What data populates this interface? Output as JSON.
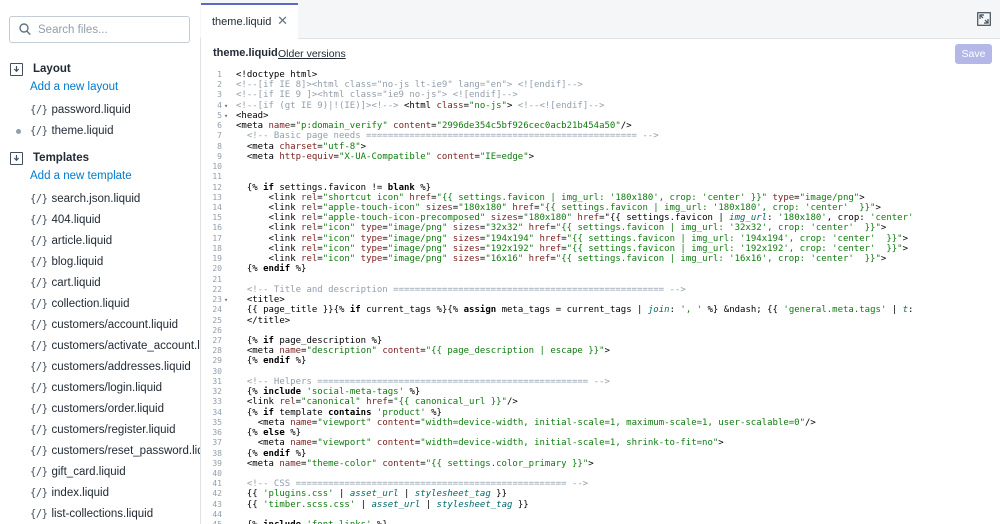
{
  "sidebar": {
    "search_placeholder": "Search files...",
    "sections": [
      {
        "title": "Layout",
        "add_label": "Add a new layout",
        "files": [
          "password.liquid",
          "theme.liquid"
        ]
      },
      {
        "title": "Templates",
        "add_label": "Add a new template",
        "files": [
          "search.json.liquid",
          "404.liquid",
          "article.liquid",
          "blog.liquid",
          "cart.liquid",
          "collection.liquid",
          "customers/account.liquid",
          "customers/activate_account.liquid",
          "customers/addresses.liquid",
          "customers/login.liquid",
          "customers/order.liquid",
          "customers/register.liquid",
          "customers/reset_password.liquid",
          "gift_card.liquid",
          "index.liquid",
          "list-collections.liquid"
        ]
      }
    ],
    "active_file": "theme.liquid"
  },
  "editor": {
    "tab_label": "theme.liquid",
    "file_title": "theme.liquid",
    "older_versions_label": "Older versions",
    "save_label": "Save"
  },
  "code": [
    {
      "n": "1",
      "f": "",
      "t": "<!doctype html>"
    },
    {
      "n": "2",
      "f": "",
      "t": "<!--[if IE 8]><html class=\"no-js lt-ie9\" lang=\"en\"> <![endif]-->"
    },
    {
      "n": "3",
      "f": "",
      "t": "<!--[if IE 9 ]><html class=\"ie9 no-js\"> <![endif]-->"
    },
    {
      "n": "4",
      "f": "▾",
      "t": "<!--[if (gt IE 9)|!(IE)]><!--> <html class=\"no-js\"> <!--<![endif]-->"
    },
    {
      "n": "5",
      "f": "▾",
      "t": "<head>"
    },
    {
      "n": "6",
      "f": "",
      "t": "<meta name=\"p:domain_verify\" content=\"2996de354c5bf926cec0acb21b454a50\"/>"
    },
    {
      "n": "7",
      "f": "",
      "t": "  <!-- Basic page needs ================================================== -->"
    },
    {
      "n": "8",
      "f": "",
      "t": "  <meta charset=\"utf-8\">"
    },
    {
      "n": "9",
      "f": "",
      "t": "  <meta http-equiv=\"X-UA-Compatible\" content=\"IE=edge\">"
    },
    {
      "n": "10",
      "f": "",
      "t": ""
    },
    {
      "n": "11",
      "f": "",
      "t": ""
    },
    {
      "n": "12",
      "f": "",
      "t": "  {% if settings.favicon != blank %}"
    },
    {
      "n": "13",
      "f": "",
      "t": "      <link rel=\"shortcut icon\" href=\"{{ settings.favicon | img_url: '180x180', crop: 'center' }}\" type=\"image/png\">"
    },
    {
      "n": "14",
      "f": "",
      "t": "      <link rel=\"apple-touch-icon\" sizes=\"180x180\" href=\"{{ settings.favicon | img_url: '180x180', crop: 'center'  }}\">"
    },
    {
      "n": "15",
      "f": "",
      "t": "      <link rel=\"apple-touch-icon-precomposed\" sizes=\"180x180\" href=\"{{ settings.favicon | img_url: '180x180', crop: 'center'"
    },
    {
      "n": "16",
      "f": "",
      "t": "      <link rel=\"icon\" type=\"image/png\" sizes=\"32x32\" href=\"{{ settings.favicon | img_url: '32x32', crop: 'center'  }}\">"
    },
    {
      "n": "17",
      "f": "",
      "t": "      <link rel=\"icon\" type=\"image/png\" sizes=\"194x194\" href=\"{{ settings.favicon | img_url: '194x194', crop: 'center'  }}\">"
    },
    {
      "n": "18",
      "f": "",
      "t": "      <link rel=\"icon\" type=\"image/png\" sizes=\"192x192\" href=\"{{ settings.favicon | img_url: '192x192', crop: 'center'  }}\">"
    },
    {
      "n": "19",
      "f": "",
      "t": "      <link rel=\"icon\" type=\"image/png\" sizes=\"16x16\" href=\"{{ settings.favicon | img_url: '16x16', crop: 'center'  }}\">"
    },
    {
      "n": "20",
      "f": "",
      "t": "  {% endif %}"
    },
    {
      "n": "21",
      "f": "",
      "t": ""
    },
    {
      "n": "22",
      "f": "",
      "t": "  <!-- Title and description ================================================== -->"
    },
    {
      "n": "23",
      "f": "▾",
      "t": "  <title>"
    },
    {
      "n": "24",
      "f": "",
      "t": "  {{ page_title }}{% if current_tags %}{% assign meta_tags = current_tags | join: ', ' %} &ndash; {{ 'general.meta.tags' | t:"
    },
    {
      "n": "25",
      "f": "",
      "t": "  </title>"
    },
    {
      "n": "26",
      "f": "",
      "t": ""
    },
    {
      "n": "27",
      "f": "",
      "t": "  {% if page_description %}"
    },
    {
      "n": "28",
      "f": "",
      "t": "  <meta name=\"description\" content=\"{{ page_description | escape }}\">"
    },
    {
      "n": "29",
      "f": "",
      "t": "  {% endif %}"
    },
    {
      "n": "30",
      "f": "",
      "t": ""
    },
    {
      "n": "31",
      "f": "",
      "t": "  <!-- Helpers ================================================== -->"
    },
    {
      "n": "32",
      "f": "",
      "t": "  {% include 'social-meta-tags' %}"
    },
    {
      "n": "33",
      "f": "",
      "t": "  <link rel=\"canonical\" href=\"{{ canonical_url }}\"/>"
    },
    {
      "n": "34",
      "f": "",
      "t": "  {% if template contains 'product' %}"
    },
    {
      "n": "35",
      "f": "",
      "t": "    <meta name=\"viewport\" content=\"width=device-width, initial-scale=1, maximum-scale=1, user-scalable=0\"/>"
    },
    {
      "n": "36",
      "f": "",
      "t": "  {% else %}"
    },
    {
      "n": "37",
      "f": "",
      "t": "    <meta name=\"viewport\" content=\"width=device-width, initial-scale=1, shrink-to-fit=no\">"
    },
    {
      "n": "38",
      "f": "",
      "t": "  {% endif %}"
    },
    {
      "n": "39",
      "f": "",
      "t": "  <meta name=\"theme-color\" content=\"{{ settings.color_primary }}\">"
    },
    {
      "n": "40",
      "f": "",
      "t": ""
    },
    {
      "n": "41",
      "f": "",
      "t": "  <!-- CSS ================================================== -->"
    },
    {
      "n": "42",
      "f": "",
      "t": "  {{ 'plugins.css' | asset_url | stylesheet_tag }}"
    },
    {
      "n": "43",
      "f": "",
      "t": "  {{ 'timber.scss.css' | asset_url | stylesheet_tag }}"
    },
    {
      "n": "44",
      "f": "",
      "t": ""
    },
    {
      "n": "45",
      "f": "",
      "t": "  {% include 'font-links' %}"
    }
  ],
  "colors": {
    "accent": "#5c6ac4",
    "link": "#007ace",
    "save_disabled": "#b3b8e8"
  }
}
